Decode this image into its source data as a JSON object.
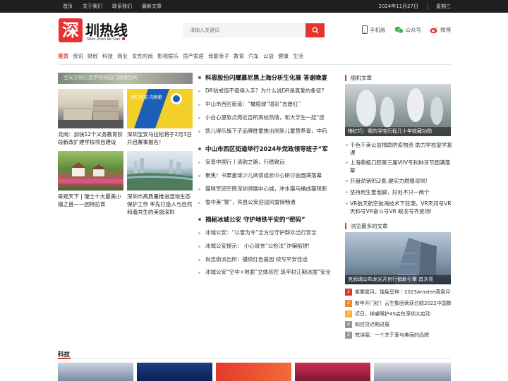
{
  "topbar": {
    "links": [
      "首页",
      "关于我们",
      "联系我们",
      "最新文章"
    ],
    "date": "2024年11月27日",
    "weekday": "星期三"
  },
  "logo": {
    "mark": "深",
    "name": "圳热线",
    "sub": "Shen Zhen Re Xian"
  },
  "search": {
    "placeholder": "请输入关键词",
    "icon": "search-icon"
  },
  "header_links": [
    {
      "label": "手机版",
      "icon": "phone-icon"
    },
    {
      "label": "公众号",
      "icon": "wechat-icon"
    },
    {
      "label": "微博",
      "icon": "weibo-icon"
    }
  ],
  "nav": [
    "首页",
    "资讯",
    "财经",
    "科技",
    "商业",
    "女性时尚",
    "影视娱乐",
    "房产家居",
    "母婴亲子",
    "教育",
    "汽车",
    "公益",
    "健康",
    "生活"
  ],
  "banner": {
    "text": "宝安文物打造学校校园门阅读空间"
  },
  "left_cards": [
    {
      "caption": "龙岗：加快12个义务教育阶段新改扩建学校项目建设"
    },
    {
      "caption": "深圳宝安马拉松将于2月3日开启赛事报名！",
      "overlay": "跑向宝安 向新跑"
    },
    {
      "caption": "奇观天下 | 瑞士十大最美小镇之首——因特拉肯"
    },
    {
      "caption": "深圳市高质量推进湿地生态保护工作 率先打造人与自然和谐共生的美丽深圳"
    }
  ],
  "middle": {
    "groups": [
      {
        "headline": "科恩股份闪耀慕尼黑上海分析生化展 答谢晚宴",
        "items": [
          "DR钴戒值不值得入手？为什么说DR是真爱的象征？",
          "中山市西区街道：“橄榄绿”增彩“志愿红”",
          "小白心里软点燃近百所高校热情，和大学生一起“皮",
          "凯儿得乐旗下子品牌胜童推出创新儿童营养膏，中药"
        ]
      },
      {
        "headline": "中山市西区街道举行2024年党政领导班子“军",
        "items": [
          "安普中国行丨清韵之路，行稳致远",
          "聚焦！书果星球少儿阅读成长中心研讨会圆满落幕",
          "猫咪军团空降深圳领展中心城，冲水猫马桶成猫咪新",
          "雪中美“警”，宾县公安迎战风雪保畅通"
        ]
      },
      {
        "headline": "揭秘冰城公安 守护地铁平安的“密码”",
        "items": [
          "冰城公安：“以雪为令”全方位守护群众出行安全",
          "冰城公安提示： 小心冒充“公检法”诈骗陷阱!",
          "尚志街派出所：播续红色基因 续写平安佳话",
          "冰城公安“空中+地面”立体巡控 筑牢封江期冰面“安全"
        ]
      }
    ]
  },
  "random": {
    "title": "随机文章",
    "image_caption": "梅红巧：我的寻宝历程几十年收藏功勋",
    "items": [
      "千色千美公益捐助防疫物资 助力学校复学复课",
      "上海鼎植口腔第三届VIIV专利种牙节圆满落幕",
      "开盘劲销952套,硬实力燃爆深圳!",
      "坚持用生姜泡脚，好处不只一两个",
      "VR航天航空航海技术下狂潮，VR天问号VR天和号VR奋斗号VR 蛟龙号齐登场!"
    ]
  },
  "popular": {
    "title": "浏览最多的文章",
    "image_caption": "克而瑞公布龙光开启行销新引擎 首次亮",
    "items": [
      "紫雾簇月，瑞兔呈祥｜2023Amalee燕窝月饼",
      "新年开门红！云生集团荣获亿欧2022中国数",
      "近日，禅睿眼护4S店在深圳大启动",
      "和信贷迟期进展",
      "梵诗篇：一个关于爱与美丽的品牌"
    ],
    "rank_colors": [
      "#e53332",
      "#f08a24",
      "#f2b632",
      "#999999",
      "#999999"
    ]
  },
  "bottom": {
    "title": "科技"
  }
}
